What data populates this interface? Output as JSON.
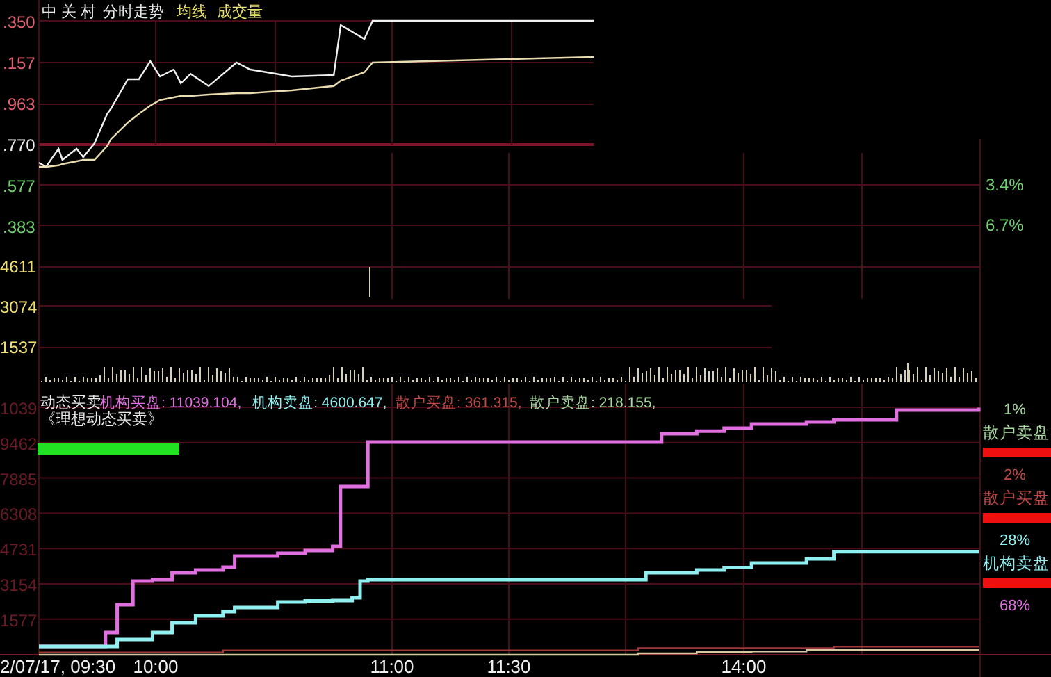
{
  "header": {
    "stock": "中 关 村",
    "labels": [
      {
        "text": "分时走势",
        "color": "#e8e8e8"
      },
      {
        "text": "均线",
        "color": "#e8e070"
      },
      {
        "text": "成交量",
        "color": "#e8e070"
      }
    ]
  },
  "price_axis": [
    {
      "label": ".350",
      "color": "#e06070"
    },
    {
      "label": ".157",
      "color": "#e06070"
    },
    {
      "label": ".963",
      "color": "#e06070"
    },
    {
      "label": ".770",
      "color": "#f0f0f0"
    },
    {
      "label": ".577",
      "color": "#70d070"
    },
    {
      "label": ".383",
      "color": "#70d070"
    }
  ],
  "percent_labels": [
    "3.4%",
    "6.7%"
  ],
  "volume_labels": [
    "4611",
    "3074",
    "1537"
  ],
  "indicator": {
    "title": "动态买卖",
    "subtitle": "《理想动态买卖》",
    "legend": [
      {
        "text": "机构买盘: 11039.104,",
        "color": "#e070e0"
      },
      {
        "text": "机构卖盘: 4600.647,",
        "color": "#90f0f0"
      },
      {
        "text": "散户买盘: 361.315,",
        "color": "#c04848"
      },
      {
        "text": "散户卖盘: 218.155,",
        "color": "#a8d8a0"
      }
    ],
    "axis_labels": [
      "1039",
      "9462",
      "7885",
      "6308",
      "4731",
      "3154",
      "1577"
    ],
    "time_labels": [
      "2/07/17, 09:30",
      "10:00",
      "11:00",
      "11:30",
      "14:00"
    ]
  },
  "ratio_legend": [
    {
      "pct": "1%",
      "label": "散户卖盘",
      "color": "#a8d8a0",
      "bar": true
    },
    {
      "pct": "2%",
      "label": "散户买盘",
      "color": "#c04848",
      "bar": true
    },
    {
      "pct": "28%",
      "label": "机构卖盘",
      "color": "#90f0f0",
      "bar": true
    },
    {
      "pct": "68%",
      "color": "#e070e0",
      "bar": false
    }
  ]
}
